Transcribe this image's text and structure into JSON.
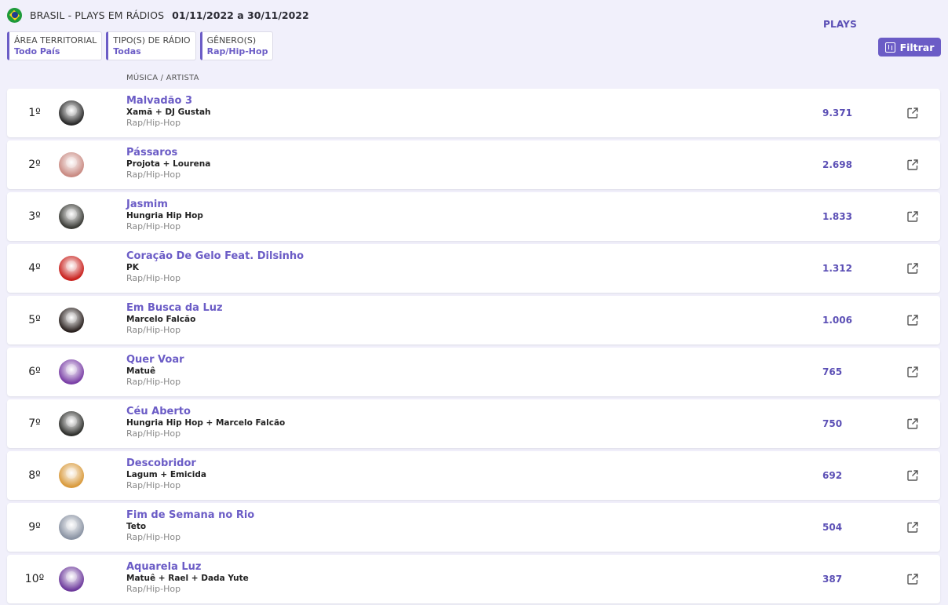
{
  "header": {
    "title": "BRASIL - PLAYS EM RÁDIOS",
    "date_range": "01/11/2022 a 30/11/2022",
    "flag_icon": "brazil-flag-icon"
  },
  "filters": [
    {
      "label": "ÁREA TERRITORIAL",
      "value": "Todo País"
    },
    {
      "label": "TIPO(S) DE RÁDIO",
      "value": "Todas"
    },
    {
      "label": "GÊNERO(S)",
      "value": "Rap/Hip-Hop"
    }
  ],
  "filter_button": {
    "label": "Filtrar",
    "icon": "sliders-icon"
  },
  "columns": {
    "music": "MÚSICA / ARTISTA",
    "plays": "PLAYS"
  },
  "colors": {
    "accent": "#6b5cc6",
    "background": "#f1f0fb"
  },
  "rows": [
    {
      "rank": "1º",
      "song": "Malvadão 3",
      "artist": "Xamã + DJ Gustah",
      "genre": "Rap/Hip-Hop",
      "plays": "9.371",
      "avatar_color": "#2a2a2a"
    },
    {
      "rank": "2º",
      "song": "Pássaros",
      "artist": "Projota + Lourena",
      "genre": "Rap/Hip-Hop",
      "plays": "2.698",
      "avatar_color": "#c98a82"
    },
    {
      "rank": "3º",
      "song": "Jasmim",
      "artist": "Hungria Hip Hop",
      "genre": "Rap/Hip-Hop",
      "plays": "1.833",
      "avatar_color": "#3a3b36"
    },
    {
      "rank": "4º",
      "song": "Coração De Gelo Feat. Dilsinho",
      "artist": "PK",
      "genre": "Rap/Hip-Hop",
      "plays": "1.312",
      "avatar_color": "#c9221e"
    },
    {
      "rank": "5º",
      "song": "Em Busca da Luz",
      "artist": "Marcelo Falcão",
      "genre": "Rap/Hip-Hop",
      "plays": "1.006",
      "avatar_color": "#2b2220"
    },
    {
      "rank": "6º",
      "song": "Quer Voar",
      "artist": "Matuê",
      "genre": "Rap/Hip-Hop",
      "plays": "765",
      "avatar_color": "#7a3fa6"
    },
    {
      "rank": "7º",
      "song": "Céu Aberto",
      "artist": "Hungria Hip Hop + Marcelo Falcão",
      "genre": "Rap/Hip-Hop",
      "plays": "750",
      "avatar_color": "#2f302d"
    },
    {
      "rank": "8º",
      "song": "Descobridor",
      "artist": "Lagum + Emicida",
      "genre": "Rap/Hip-Hop",
      "plays": "692",
      "avatar_color": "#d99a3c"
    },
    {
      "rank": "9º",
      "song": "Fim de Semana no Rio",
      "artist": "Teto",
      "genre": "Rap/Hip-Hop",
      "plays": "504",
      "avatar_color": "#8a93a3"
    },
    {
      "rank": "10º",
      "song": "Aquarela Luz",
      "artist": "Matuê + Rael + Dada Yute",
      "genre": "Rap/Hip-Hop",
      "plays": "387",
      "avatar_color": "#6d3a9c"
    }
  ]
}
